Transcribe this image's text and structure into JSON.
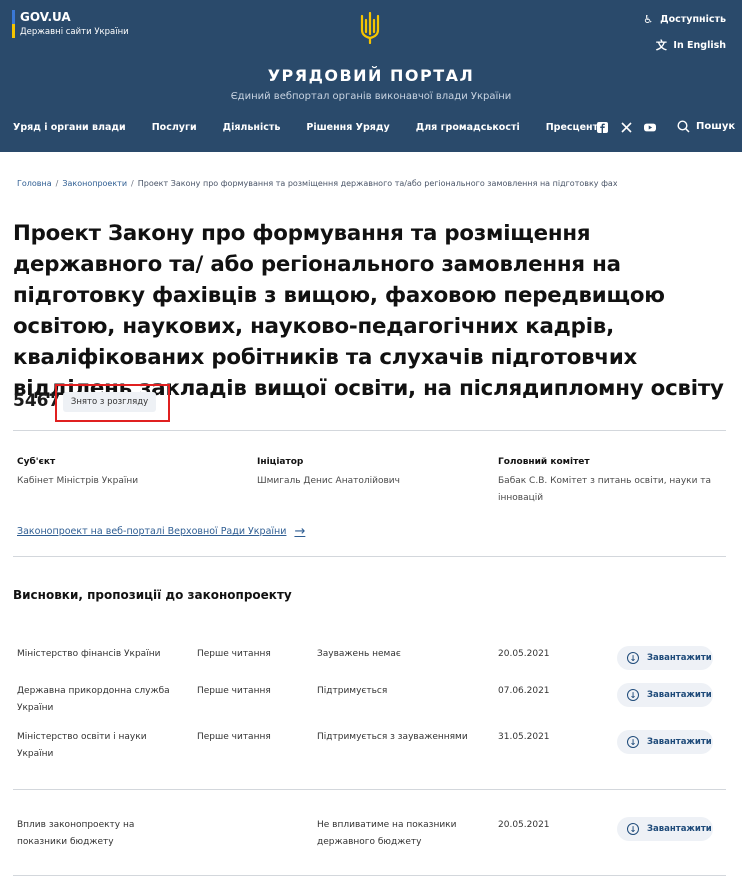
{
  "header": {
    "gov_title": "GOV.UA",
    "gov_sub": "Державні сайти України",
    "accessibility": "Доступність",
    "language": "In English",
    "portal_title": "УРЯДОВИЙ ПОРТАЛ",
    "portal_sub": "Єдиний вебпортал органів виконавчої влади України",
    "nav": [
      "Уряд і органи влади",
      "Послуги",
      "Діяльність",
      "Рішення Уряду",
      "Для громадськості",
      "Пресцентр"
    ],
    "search": "Пошук",
    "colors": {
      "header_bg": "#2a4a6b",
      "accent": "#f5c400",
      "link": "#2f5e93",
      "highlight": "#e02020"
    }
  },
  "breadcrumb": {
    "home": "Головна",
    "section": "Законопроекти",
    "current": "Проект Закону про формування та розміщення державного та/або регіонального замовлення на підготовку фахівців з вищо..."
  },
  "bill": {
    "title": "Проект Закону про формування та розміщення державного та/ або регіонального замовлення на підготовку фахівців з вищою, фаховою передвищою освітою, наукових, науково-педагогічних кадрів, кваліфікованих робітників та слухачів підготовчих відділень закладів вищої освіти, на післядипломну освіту",
    "number": "5467",
    "status": "Знято з розгляду"
  },
  "info": {
    "subject_label": "Суб'єкт",
    "subject_value": "Кабінет Міністрів України",
    "initiator_label": "Ініціатор",
    "initiator_value": "Шмигаль Денис Анатолійович",
    "committee_label": "Головний комітет",
    "committee_value": "Бабак С.В. Комітет з питань освіти, науки та інновацій"
  },
  "rada_link": "Законопроект на веб-порталі Верховної Ради України",
  "conclusions": {
    "title": "Висновки, пропозиції до законопроекту",
    "download_label": "Завантажити",
    "rows": [
      {
        "org": "Міністерство фінансів України",
        "reading": "Перше читання",
        "result": "Зауважень немає",
        "date": "20.05.2021"
      },
      {
        "org": "Державна прикордонна служба України",
        "reading": "Перше читання",
        "result": "Підтримується",
        "date": "07.06.2021"
      },
      {
        "org": "Міністерство освіти і науки України",
        "reading": "Перше читання",
        "result": "Підтримується з зауваженнями",
        "date": "31.05.2021"
      }
    ],
    "impact": {
      "org": "Вплив законопроекту на показники бюджету",
      "reading": "",
      "result": "Не впливатиме на показники державного бюджету",
      "date": "20.05.2021"
    }
  }
}
